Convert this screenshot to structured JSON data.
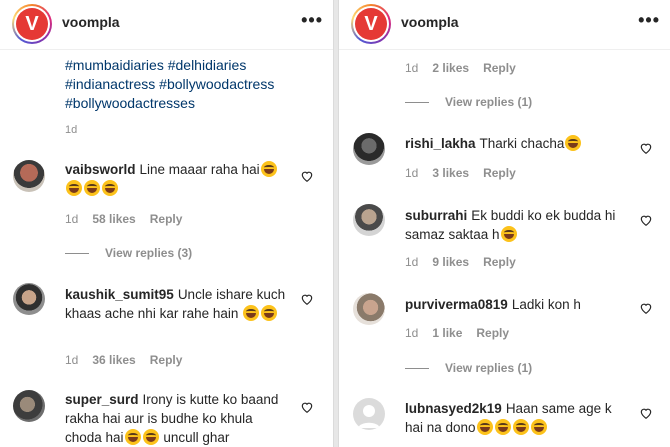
{
  "account": {
    "username": "voompla",
    "logo_letter": "V"
  },
  "caption": {
    "hashtags": [
      "#mumbaidiaries #delhidiaries",
      "#indianactress #bollywoodactress",
      "#bollywoodactresses"
    ],
    "time": "1d"
  },
  "left_comments": [
    {
      "username": "vaibsworld",
      "text": "Line maaar raha hai",
      "time": "1d",
      "likes": "58 likes",
      "reply": "Reply",
      "view_replies": "View replies (3)"
    },
    {
      "username": "kaushik_sumit95",
      "text": "Uncle ishare kuch khaas ache nhi kar rahe hain",
      "time": "1d",
      "likes": "36 likes",
      "reply": "Reply"
    },
    {
      "username": "super_surd",
      "text": "Irony is kutte ko baand rakha hai aur is budhe ko khula choda hai",
      "text2": "uncull ghar"
    }
  ],
  "right_top": {
    "time": "1d",
    "likes": "2 likes",
    "reply": "Reply",
    "view_replies": "View replies (1)"
  },
  "right_comments": [
    {
      "username": "rishi_lakha",
      "text": "Tharki chacha",
      "time": "1d",
      "likes": "3 likes",
      "reply": "Reply"
    },
    {
      "username": "suburrahi",
      "text": "Ek buddi ko ek budda hi samaz saktaa h",
      "time": "1d",
      "likes": "9 likes",
      "reply": "Reply"
    },
    {
      "username": "purviverma0819",
      "text": "Ladki kon h",
      "time": "1d",
      "likes": "1 like",
      "reply": "Reply",
      "view_replies": "View replies (1)"
    },
    {
      "username": "lubnasyed2k19",
      "text": "Haan same age k hai na dono"
    }
  ]
}
